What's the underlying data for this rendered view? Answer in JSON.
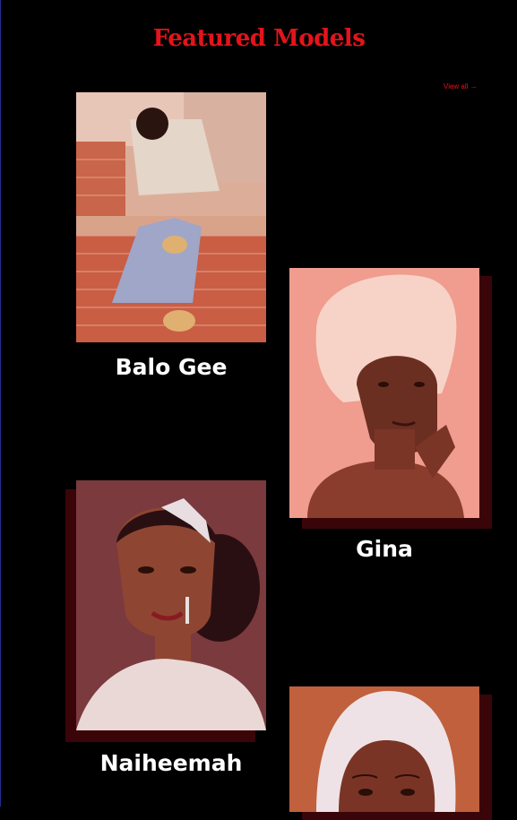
{
  "section": {
    "title": "Featured Models",
    "view_all": "View all →"
  },
  "models": [
    {
      "name": "Balo Gee"
    },
    {
      "name": "Gina"
    },
    {
      "name": "Naiheemah"
    },
    {
      "name": ""
    }
  ],
  "colors": {
    "accent": "#e3141b",
    "background": "#000000",
    "shadow": "#3a0508",
    "overlay": "#f07a72"
  }
}
